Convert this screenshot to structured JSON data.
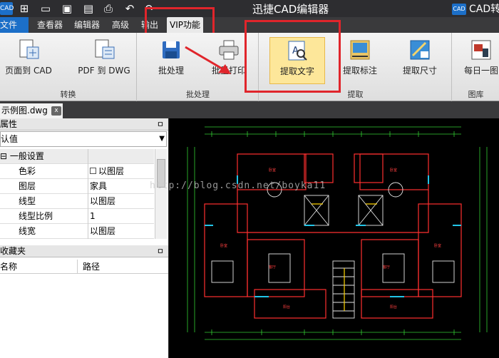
{
  "titlebar": {
    "app_badge": "CAD",
    "title": "迅捷CAD编辑器",
    "brand_logo": "CAD",
    "brand_text": "CAD转",
    "icons": [
      "new-icon",
      "open-icon",
      "save-icon",
      "save-as-icon",
      "print-icon",
      "undo-icon",
      "redo-icon"
    ]
  },
  "menubar": {
    "items": [
      "文件",
      "查看器",
      "编辑器",
      "高级",
      "输出",
      "VIP功能"
    ]
  },
  "ribbon": {
    "groups": [
      {
        "label": "转换",
        "buttons": [
          "页面到 CAD",
          "PDF 到 DWG"
        ]
      },
      {
        "label": "批处理",
        "buttons": [
          "批处理",
          "批量打印"
        ]
      },
      {
        "label": "提取",
        "buttons": [
          "提取文字",
          "提取标注",
          "提取尺寸"
        ]
      },
      {
        "label": "图库",
        "buttons": [
          "每日一图"
        ]
      }
    ]
  },
  "doc_tab": {
    "name": "示例图.dwg",
    "close": "x"
  },
  "properties": {
    "title": "属性",
    "pin": "ㅁ",
    "combo_value": "认值",
    "rows": [
      {
        "key": "一般设置",
        "value": "",
        "group": true
      },
      {
        "key": "色彩",
        "value": "以图层"
      },
      {
        "key": "图层",
        "value": "家具"
      },
      {
        "key": "线型",
        "value": "以图层"
      },
      {
        "key": "线型比例",
        "value": "1"
      },
      {
        "key": "线宽",
        "value": "以图层"
      }
    ]
  },
  "favorites": {
    "title": "收藏夹",
    "pin": "ㅁ",
    "col_name": "名称",
    "col_path": "路径"
  },
  "watermark": "http://blog.csdn.net/boyka11",
  "colors": {
    "accent": "#1c6fc8",
    "highlight_box": "#e0252b",
    "active_button": "#fde79a",
    "cad_background": "#000000",
    "wall_red": "#ff3030",
    "dim_green": "#33cc33"
  }
}
